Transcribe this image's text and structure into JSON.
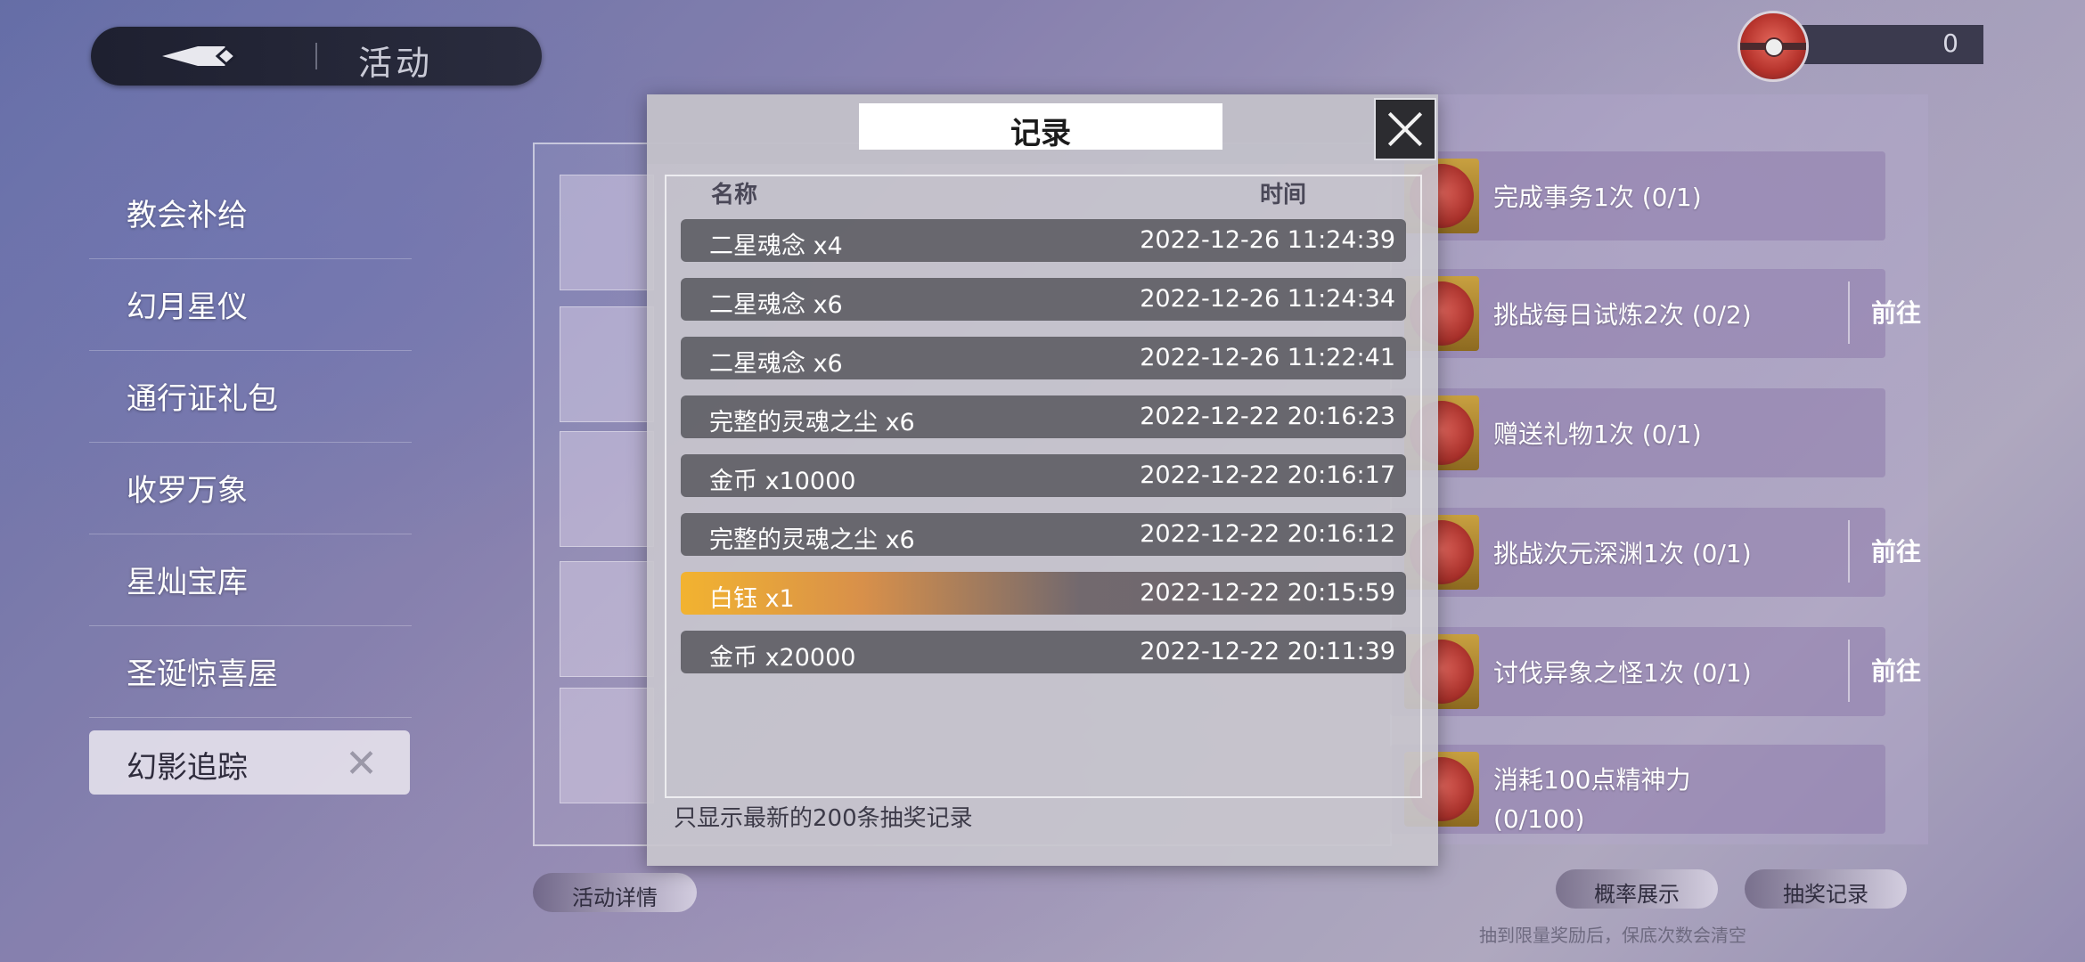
{
  "header": {
    "title": "活动"
  },
  "currency": {
    "value": "0"
  },
  "menu": {
    "items": [
      {
        "label": "教会补给"
      },
      {
        "label": "幻月星仪"
      },
      {
        "label": "通行证礼包"
      },
      {
        "label": "收罗万象"
      },
      {
        "label": "星灿宝库"
      },
      {
        "label": "圣诞惊喜屋"
      },
      {
        "label": "幻影追踪",
        "active": true
      }
    ]
  },
  "tasks": [
    {
      "label": "完成事务1次 (0/1)",
      "go": ""
    },
    {
      "label": "挑战每日试炼2次 (0/2)",
      "go": "前往"
    },
    {
      "label": "赠送礼物1次 (0/1)",
      "go": ""
    },
    {
      "label": "挑战次元深渊1次 (0/1)",
      "go": "前往"
    },
    {
      "label": "讨伐异象之怪1次 (0/1)",
      "go": "前往"
    },
    {
      "label_line1": "消耗100点精神力",
      "label_line2": "(0/100)",
      "go": ""
    }
  ],
  "buttons": {
    "activity_details": "活动详情",
    "probability": "概率展示",
    "draw_record": "抽奖记录"
  },
  "bottom_note": "抽到限量奖励后，保底次数会清空",
  "modal": {
    "title": "记录",
    "col_name": "名称",
    "col_time": "时间",
    "rows": [
      {
        "name": "二星魂念 x4",
        "time": "2022-12-26 11:24:39"
      },
      {
        "name": "二星魂念 x6",
        "time": "2022-12-26 11:24:34"
      },
      {
        "name": "二星魂念 x6",
        "time": "2022-12-26 11:22:41"
      },
      {
        "name": "完整的灵魂之尘 x6",
        "time": "2022-12-22 20:16:23"
      },
      {
        "name": "金币 x10000",
        "time": "2022-12-22 20:16:17"
      },
      {
        "name": "完整的灵魂之尘 x6",
        "time": "2022-12-22 20:16:12"
      },
      {
        "name": "白钰 x1",
        "time": "2022-12-22 20:15:59",
        "highlight": true
      },
      {
        "name": "金币 x20000",
        "time": "2022-12-22 20:11:39"
      }
    ],
    "footer": "只显示最新的200条抽奖记录"
  },
  "colors": {
    "highlight": "#f2b330",
    "row_bg": "#5f5f66",
    "header_bg": "#1e2030"
  }
}
